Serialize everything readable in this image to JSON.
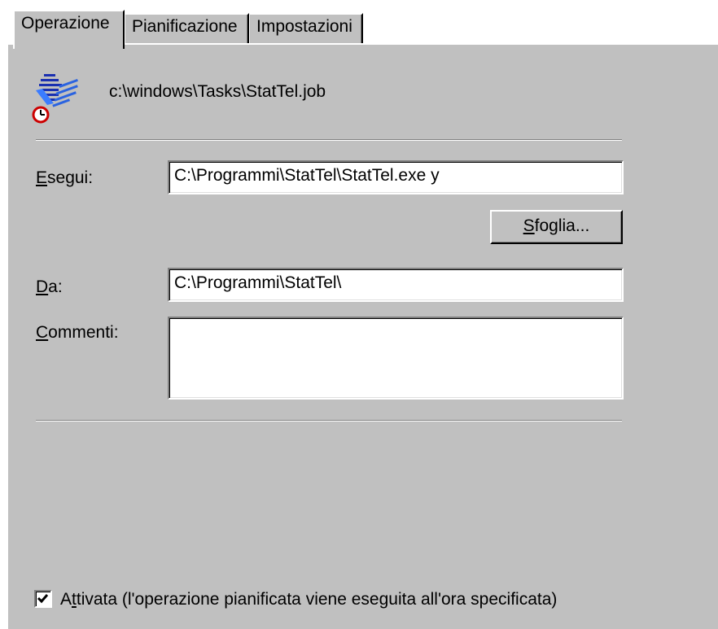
{
  "tabs": [
    {
      "label": "Operazione",
      "active": true
    },
    {
      "label": "Pianificazione",
      "active": false
    },
    {
      "label": "Impostazioni",
      "active": false
    }
  ],
  "job": {
    "path": "c:\\windows\\Tasks\\StatTel.job",
    "icon": "scheduled-task-icon"
  },
  "esegui": {
    "label_accel": "E",
    "label_rest": "segui:",
    "value": "C:\\Programmi\\StatTel\\StatTel.exe y"
  },
  "browse": {
    "label_accel": "S",
    "label_rest": "foglia..."
  },
  "da": {
    "label_accel": "D",
    "label_rest": "a:",
    "value": "C:\\Programmi\\StatTel\\"
  },
  "commenti": {
    "label_accel": "C",
    "label_rest": "ommenti:",
    "value": ""
  },
  "attivata": {
    "checked": true,
    "label_pre": "A",
    "label_accel": "t",
    "label_rest": "tivata (l'operazione pianificata viene eseguita all'ora specificata)"
  },
  "colors": {
    "dialog_face": "#c0c0c0",
    "field_bg": "#ffffff"
  }
}
